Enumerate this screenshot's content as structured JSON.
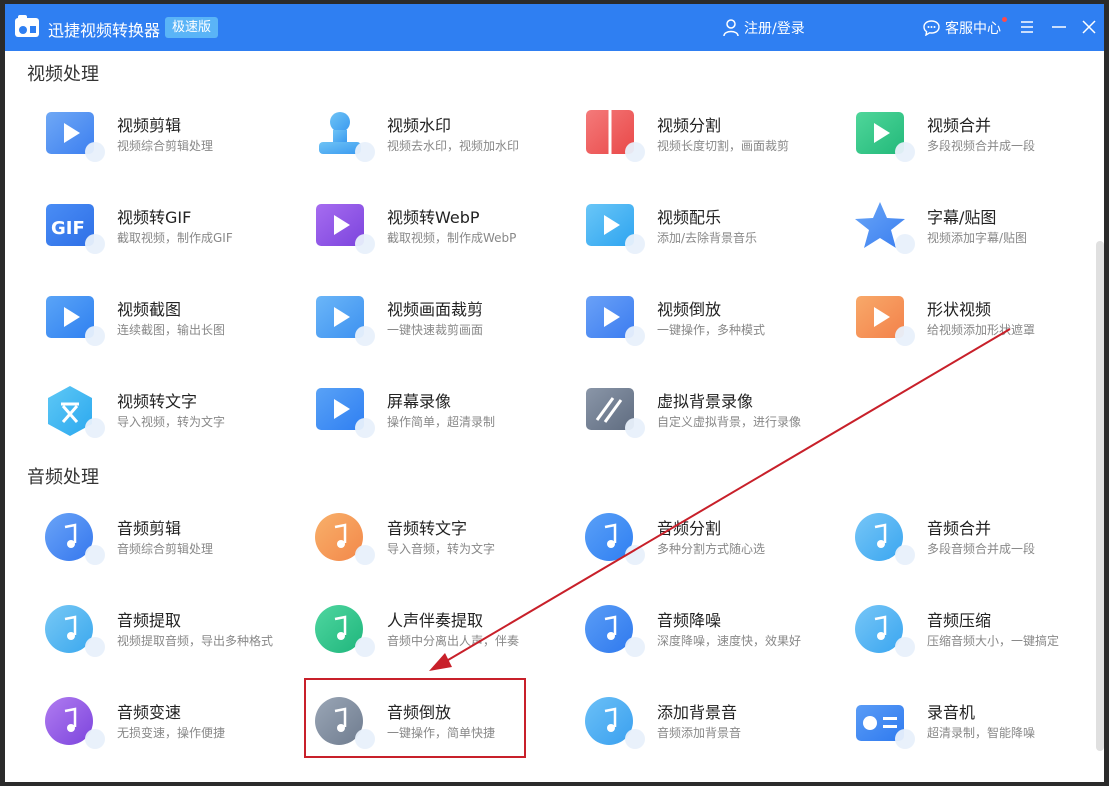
{
  "app": {
    "title": "迅捷视频转换器",
    "edition": "极速版",
    "user_label": "注册/登录",
    "support_label": "客服中心"
  },
  "icons": {
    "logo": "camera-logo-icon",
    "user": "user-icon",
    "support": "chat-bubble-icon",
    "menu": "hamburger-menu-icon",
    "minimize": "minimize-icon",
    "close": "close-icon"
  },
  "colors": {
    "titlebar": "#2f7ff2",
    "badge": "#5ab4f7",
    "annotation": "#c8202a"
  },
  "video_section": {
    "title": "视频处理",
    "items": [
      {
        "name": "video-edit",
        "title": "视频剪辑",
        "desc": "视频综合剪辑处理"
      },
      {
        "name": "video-watermark",
        "title": "视频水印",
        "desc": "视频去水印，视频加水印"
      },
      {
        "name": "video-split",
        "title": "视频分割",
        "desc": "视频长度切割，画面裁剪"
      },
      {
        "name": "video-merge",
        "title": "视频合并",
        "desc": "多段视频合并成一段"
      },
      {
        "name": "video-to-gif",
        "title": "视频转GIF",
        "desc": "截取视频，制作成GIF"
      },
      {
        "name": "video-to-webp",
        "title": "视频转WebP",
        "desc": "截取视频，制作成WebP"
      },
      {
        "name": "video-music",
        "title": "视频配乐",
        "desc": "添加/去除背景音乐"
      },
      {
        "name": "subtitle-sticker",
        "title": "字幕/贴图",
        "desc": "视频添加字幕/贴图"
      },
      {
        "name": "video-screenshot",
        "title": "视频截图",
        "desc": "连续截图，输出长图"
      },
      {
        "name": "video-crop",
        "title": "视频画面裁剪",
        "desc": "一键快速裁剪画面"
      },
      {
        "name": "video-reverse",
        "title": "视频倒放",
        "desc": "一键操作，多种模式"
      },
      {
        "name": "shape-video",
        "title": "形状视频",
        "desc": "给视频添加形状遮罩"
      },
      {
        "name": "video-to-text",
        "title": "视频转文字",
        "desc": "导入视频，转为文字"
      },
      {
        "name": "screen-record",
        "title": "屏幕录像",
        "desc": "操作简单，超清录制"
      },
      {
        "name": "virtual-bg-record",
        "title": "虚拟背景录像",
        "desc": "自定义虚拟背景，进行录像"
      }
    ]
  },
  "audio_section": {
    "title": "音频处理",
    "items": [
      {
        "name": "audio-edit",
        "title": "音频剪辑",
        "desc": "音频综合剪辑处理"
      },
      {
        "name": "audio-to-text",
        "title": "音频转文字",
        "desc": "导入音频，转为文字"
      },
      {
        "name": "audio-split",
        "title": "音频分割",
        "desc": "多种分割方式随心选"
      },
      {
        "name": "audio-merge",
        "title": "音频合并",
        "desc": "多段音频合并成一段"
      },
      {
        "name": "audio-extract",
        "title": "音频提取",
        "desc": "视频提取音频，导出多种格式"
      },
      {
        "name": "vocal-extract",
        "title": "人声伴奏提取",
        "desc": "音频中分离出人声，伴奏"
      },
      {
        "name": "audio-denoise",
        "title": "音频降噪",
        "desc": "深度降噪，速度快，效果好"
      },
      {
        "name": "audio-compress",
        "title": "音频压缩",
        "desc": "压缩音频大小，一键搞定"
      },
      {
        "name": "audio-speed",
        "title": "音频变速",
        "desc": "无损变速，操作便捷"
      },
      {
        "name": "audio-reverse",
        "title": "音频倒放",
        "desc": "一键操作，简单快捷"
      },
      {
        "name": "add-bg-music",
        "title": "添加背景音",
        "desc": "音频添加背景音"
      },
      {
        "name": "recorder",
        "title": "录音机",
        "desc": "超清录制，智能降噪"
      }
    ]
  }
}
